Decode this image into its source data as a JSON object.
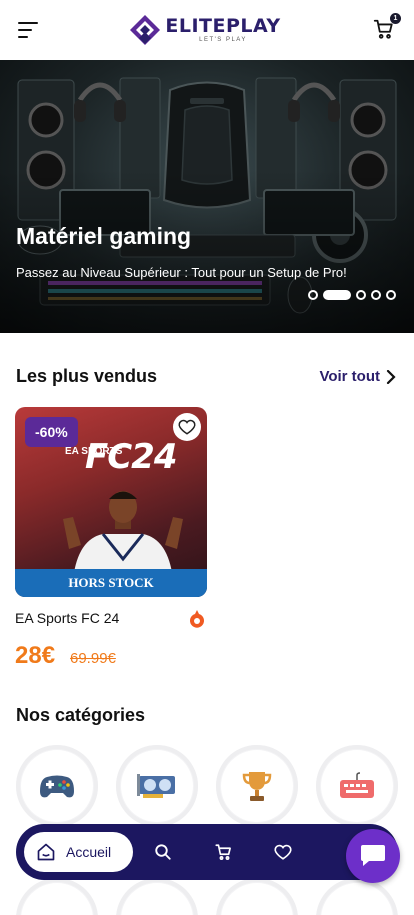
{
  "brand": {
    "name": "ELITEPLAY",
    "tagline": "LET'S PLAY",
    "primary": "#2b1f6b",
    "accent": "#f07a1a"
  },
  "header": {
    "menu_icon": "hamburger-icon",
    "cart_icon": "cart-icon",
    "cart_count": "1"
  },
  "hero": {
    "title": "Matériel gaming",
    "subtitle": "Passez au Niveau Supérieur : Tout pour un Setup de Pro!",
    "slide_count": 5,
    "active_slide": 2
  },
  "best_sellers": {
    "title": "Les plus vendus",
    "see_all": "Voir tout",
    "products": [
      {
        "name": "EA Sports FC 24",
        "discount": "-60%",
        "stock_status": "HORS STOCK",
        "price": "28€",
        "old_price": "69.99€",
        "cover_title": "FC24",
        "cover_brand": "EA SPORTS"
      }
    ]
  },
  "categories": {
    "title": "Nos catégories",
    "items": [
      {
        "icon": "gamepad-icon"
      },
      {
        "icon": "graphics-card-icon"
      },
      {
        "icon": "trophy-icon"
      },
      {
        "icon": "keyboard-icon"
      }
    ]
  },
  "bottom_nav": {
    "home_label": "Accueil",
    "items": [
      "search-icon",
      "cart-icon",
      "heart-icon"
    ]
  },
  "chat": {
    "icon": "chat-icon"
  }
}
